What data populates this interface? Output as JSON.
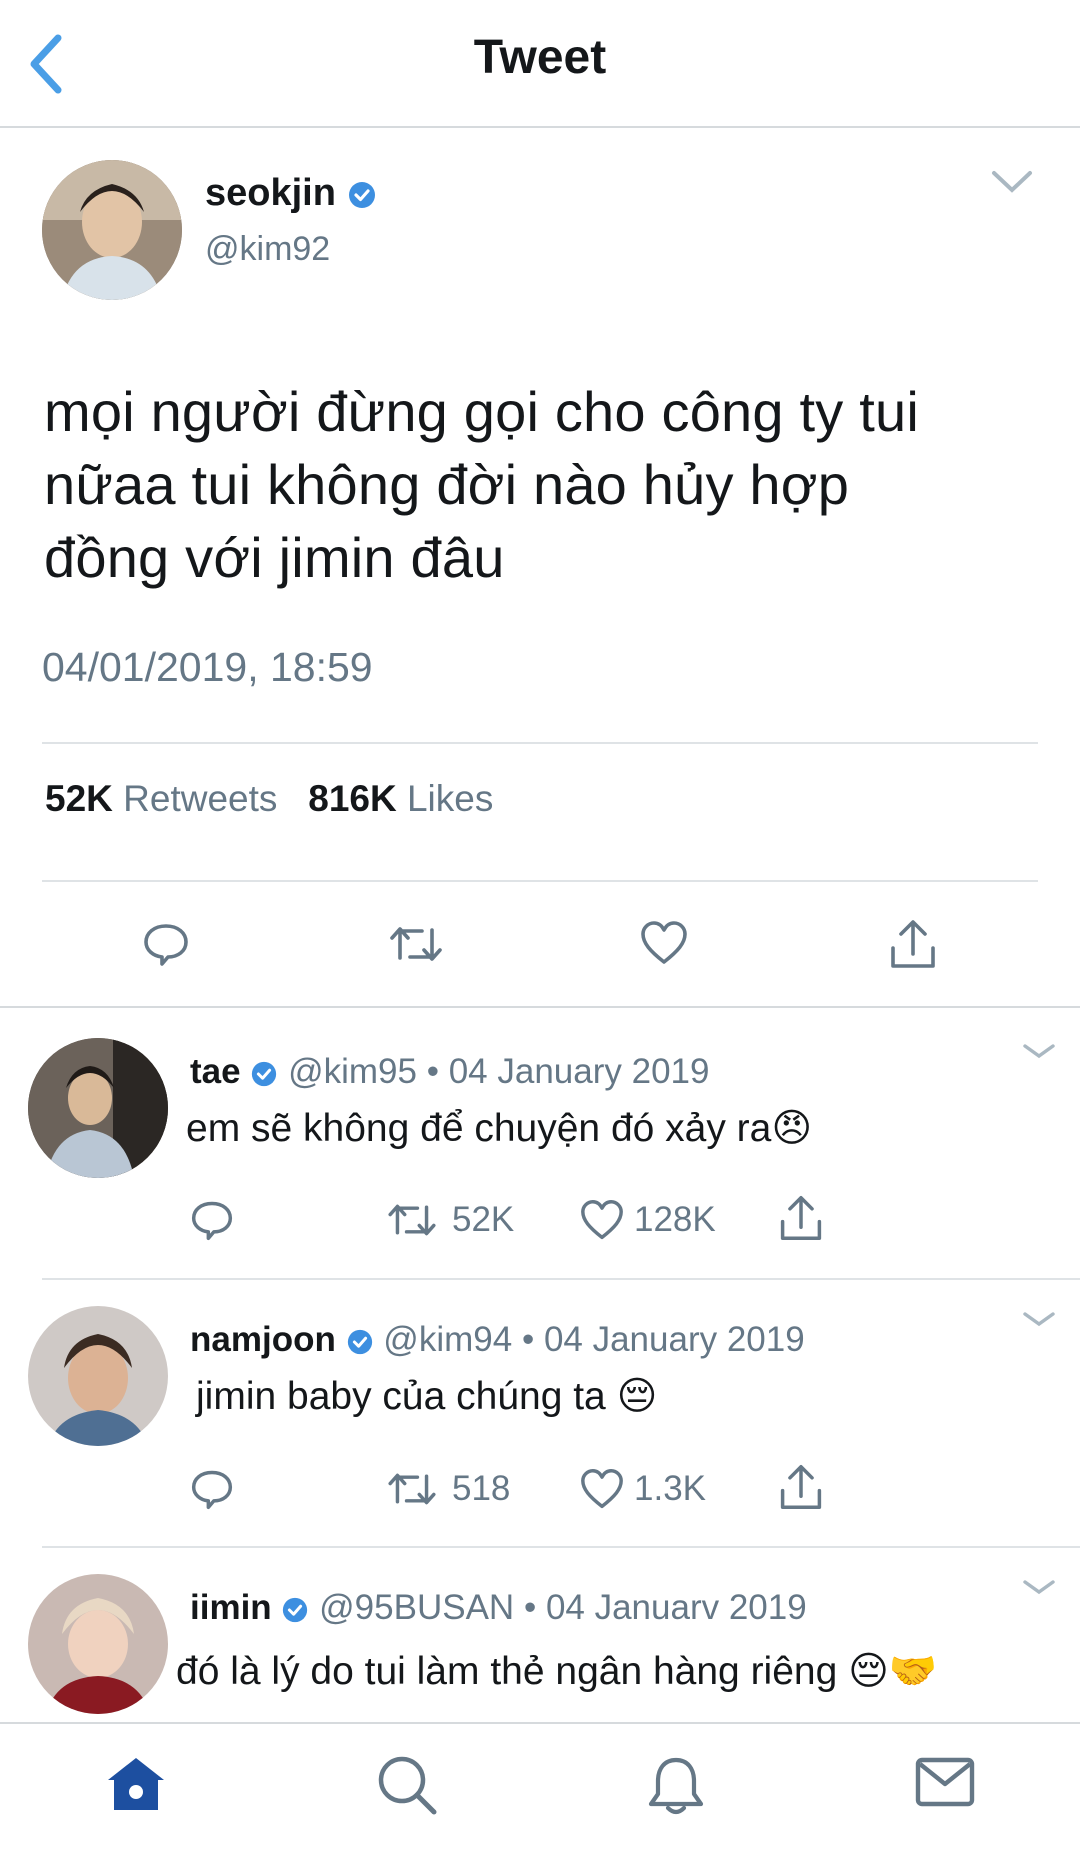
{
  "header": {
    "title": "Tweet",
    "back_icon": "chevron-left-icon",
    "accent": "#4a9ee6"
  },
  "tweet": {
    "name": "seokjin",
    "handle": "@kim92",
    "text_lines": [
      "mọi người đừng gọi cho công ty tui",
      "nữaa tui không đời nào hủy hợp",
      "đồng với jimin đâu"
    ],
    "timestamp": "04/01/2019, 18:59",
    "retweets_count": "52K",
    "retweets_label": "Retweets",
    "likes_count": "816K",
    "likes_label": "Likes",
    "actions": [
      "reply-icon",
      "retweet-icon",
      "like-icon",
      "share-icon"
    ]
  },
  "replies": [
    {
      "name": "tae",
      "handle": "@kim95",
      "sep": "•",
      "date": "04 January 2019",
      "text": "em sẽ không để chuyện đó xảy ra😠",
      "retweets": "52K",
      "likes": "128K"
    },
    {
      "name": "namjoon",
      "handle": "@kim94",
      "sep": "•",
      "date": "04 January 2019",
      "text": "jimin baby của chúng ta 😔",
      "retweets": "518",
      "likes": "1.3K"
    },
    {
      "name": "iimin",
      "handle": "@95BUSAN",
      "sep": "•",
      "date": "04 Januarv 2019",
      "text": "đó là lý do tui làm thẻ ngân hàng riêng 😔🤝"
    }
  ],
  "tabbar": {
    "icons": [
      "home-icon",
      "search-icon",
      "notifications-icon",
      "messages-icon"
    ],
    "active_color": "#1d4fa0"
  },
  "colors": {
    "verified": "#3d8fe0",
    "muted": "#657786",
    "divider": "#dfe3e6"
  }
}
